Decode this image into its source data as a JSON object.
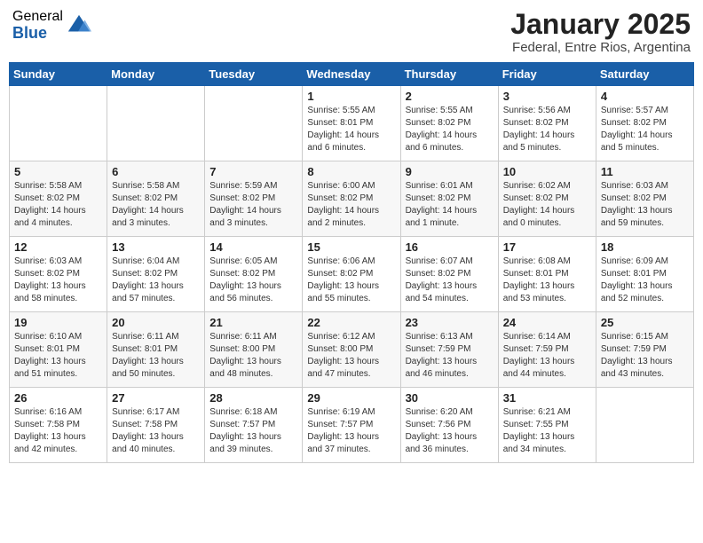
{
  "logo": {
    "general": "General",
    "blue": "Blue"
  },
  "title": "January 2025",
  "subtitle": "Federal, Entre Rios, Argentina",
  "headers": [
    "Sunday",
    "Monday",
    "Tuesday",
    "Wednesday",
    "Thursday",
    "Friday",
    "Saturday"
  ],
  "weeks": [
    [
      {
        "day": "",
        "info": ""
      },
      {
        "day": "",
        "info": ""
      },
      {
        "day": "",
        "info": ""
      },
      {
        "day": "1",
        "info": "Sunrise: 5:55 AM\nSunset: 8:01 PM\nDaylight: 14 hours\nand 6 minutes."
      },
      {
        "day": "2",
        "info": "Sunrise: 5:55 AM\nSunset: 8:02 PM\nDaylight: 14 hours\nand 6 minutes."
      },
      {
        "day": "3",
        "info": "Sunrise: 5:56 AM\nSunset: 8:02 PM\nDaylight: 14 hours\nand 5 minutes."
      },
      {
        "day": "4",
        "info": "Sunrise: 5:57 AM\nSunset: 8:02 PM\nDaylight: 14 hours\nand 5 minutes."
      }
    ],
    [
      {
        "day": "5",
        "info": "Sunrise: 5:58 AM\nSunset: 8:02 PM\nDaylight: 14 hours\nand 4 minutes."
      },
      {
        "day": "6",
        "info": "Sunrise: 5:58 AM\nSunset: 8:02 PM\nDaylight: 14 hours\nand 3 minutes."
      },
      {
        "day": "7",
        "info": "Sunrise: 5:59 AM\nSunset: 8:02 PM\nDaylight: 14 hours\nand 3 minutes."
      },
      {
        "day": "8",
        "info": "Sunrise: 6:00 AM\nSunset: 8:02 PM\nDaylight: 14 hours\nand 2 minutes."
      },
      {
        "day": "9",
        "info": "Sunrise: 6:01 AM\nSunset: 8:02 PM\nDaylight: 14 hours\nand 1 minute."
      },
      {
        "day": "10",
        "info": "Sunrise: 6:02 AM\nSunset: 8:02 PM\nDaylight: 14 hours\nand 0 minutes."
      },
      {
        "day": "11",
        "info": "Sunrise: 6:03 AM\nSunset: 8:02 PM\nDaylight: 13 hours\nand 59 minutes."
      }
    ],
    [
      {
        "day": "12",
        "info": "Sunrise: 6:03 AM\nSunset: 8:02 PM\nDaylight: 13 hours\nand 58 minutes."
      },
      {
        "day": "13",
        "info": "Sunrise: 6:04 AM\nSunset: 8:02 PM\nDaylight: 13 hours\nand 57 minutes."
      },
      {
        "day": "14",
        "info": "Sunrise: 6:05 AM\nSunset: 8:02 PM\nDaylight: 13 hours\nand 56 minutes."
      },
      {
        "day": "15",
        "info": "Sunrise: 6:06 AM\nSunset: 8:02 PM\nDaylight: 13 hours\nand 55 minutes."
      },
      {
        "day": "16",
        "info": "Sunrise: 6:07 AM\nSunset: 8:02 PM\nDaylight: 13 hours\nand 54 minutes."
      },
      {
        "day": "17",
        "info": "Sunrise: 6:08 AM\nSunset: 8:01 PM\nDaylight: 13 hours\nand 53 minutes."
      },
      {
        "day": "18",
        "info": "Sunrise: 6:09 AM\nSunset: 8:01 PM\nDaylight: 13 hours\nand 52 minutes."
      }
    ],
    [
      {
        "day": "19",
        "info": "Sunrise: 6:10 AM\nSunset: 8:01 PM\nDaylight: 13 hours\nand 51 minutes."
      },
      {
        "day": "20",
        "info": "Sunrise: 6:11 AM\nSunset: 8:01 PM\nDaylight: 13 hours\nand 50 minutes."
      },
      {
        "day": "21",
        "info": "Sunrise: 6:11 AM\nSunset: 8:00 PM\nDaylight: 13 hours\nand 48 minutes."
      },
      {
        "day": "22",
        "info": "Sunrise: 6:12 AM\nSunset: 8:00 PM\nDaylight: 13 hours\nand 47 minutes."
      },
      {
        "day": "23",
        "info": "Sunrise: 6:13 AM\nSunset: 7:59 PM\nDaylight: 13 hours\nand 46 minutes."
      },
      {
        "day": "24",
        "info": "Sunrise: 6:14 AM\nSunset: 7:59 PM\nDaylight: 13 hours\nand 44 minutes."
      },
      {
        "day": "25",
        "info": "Sunrise: 6:15 AM\nSunset: 7:59 PM\nDaylight: 13 hours\nand 43 minutes."
      }
    ],
    [
      {
        "day": "26",
        "info": "Sunrise: 6:16 AM\nSunset: 7:58 PM\nDaylight: 13 hours\nand 42 minutes."
      },
      {
        "day": "27",
        "info": "Sunrise: 6:17 AM\nSunset: 7:58 PM\nDaylight: 13 hours\nand 40 minutes."
      },
      {
        "day": "28",
        "info": "Sunrise: 6:18 AM\nSunset: 7:57 PM\nDaylight: 13 hours\nand 39 minutes."
      },
      {
        "day": "29",
        "info": "Sunrise: 6:19 AM\nSunset: 7:57 PM\nDaylight: 13 hours\nand 37 minutes."
      },
      {
        "day": "30",
        "info": "Sunrise: 6:20 AM\nSunset: 7:56 PM\nDaylight: 13 hours\nand 36 minutes."
      },
      {
        "day": "31",
        "info": "Sunrise: 6:21 AM\nSunset: 7:55 PM\nDaylight: 13 hours\nand 34 minutes."
      },
      {
        "day": "",
        "info": ""
      }
    ]
  ]
}
